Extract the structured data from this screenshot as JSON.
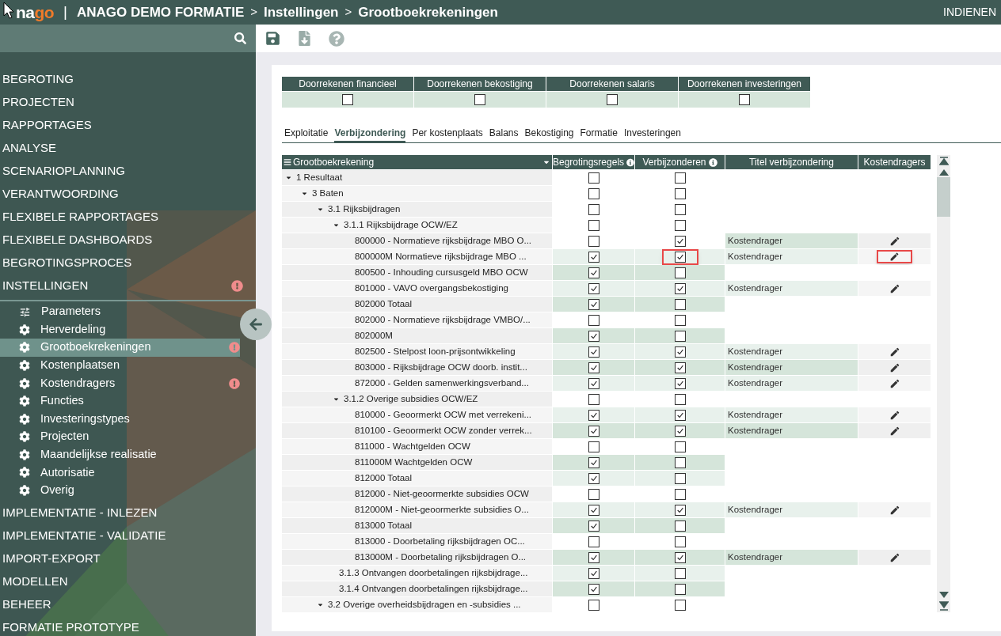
{
  "header": {
    "logo": {
      "main": "na",
      "accent": "go"
    },
    "logo_divider": "|",
    "breadcrumb": [
      {
        "kind": "crumb",
        "text": "ANAGO DEMO FORMATIE"
      },
      {
        "kind": "separator",
        "text": ">"
      },
      {
        "kind": "crumb",
        "text": "Instellingen"
      },
      {
        "kind": "separator",
        "text": ">"
      },
      {
        "kind": "crumb",
        "text": "Grootboekrekeningen"
      }
    ],
    "action": "INDIENEN"
  },
  "sidebar": {
    "items": [
      {
        "label": "BEGROTING"
      },
      {
        "label": "PROJECTEN"
      },
      {
        "label": "RAPPORTAGES"
      },
      {
        "label": "ANALYSE"
      },
      {
        "label": "SCENARIOPLANNING"
      },
      {
        "label": "VERANTWOORDING"
      },
      {
        "label": "FLEXIBELE RAPPORTAGES"
      },
      {
        "label": "FLEXIBELE DASHBOARDS"
      },
      {
        "label": "BEGROTINGSPROCES"
      },
      {
        "label": "INSTELLINGEN",
        "alert": true,
        "children": [
          {
            "label": "Parameters",
            "kind": "sliders",
            "selected": false,
            "alert": false
          },
          {
            "label": "Herverdeling",
            "kind": "gear",
            "selected": false,
            "alert": false
          },
          {
            "label": "Grootboekrekeningen",
            "kind": "gear",
            "selected": true,
            "alert": true
          },
          {
            "label": "Kostenplaatsen",
            "kind": "gear",
            "selected": false,
            "alert": false
          },
          {
            "label": "Kostendragers",
            "kind": "gear",
            "selected": false,
            "alert": true
          },
          {
            "label": "Functies",
            "kind": "gear",
            "selected": false,
            "alert": false
          },
          {
            "label": "Investeringstypes",
            "kind": "gear",
            "selected": false,
            "alert": false
          },
          {
            "label": "Projecten",
            "kind": "gear",
            "selected": false,
            "alert": false
          },
          {
            "label": "Maandelijkse realisatie",
            "kind": "gear",
            "selected": false,
            "alert": false
          },
          {
            "label": "Autorisatie",
            "kind": "gear",
            "selected": false,
            "alert": false
          },
          {
            "label": "Overig",
            "kind": "gear",
            "selected": false,
            "alert": false
          }
        ]
      },
      {
        "label": "IMPLEMENTATIE - INLEZEN"
      },
      {
        "label": "IMPLEMENTATIE - VALIDATIE"
      },
      {
        "label": "IMPORT-EXPORT"
      },
      {
        "label": "MODELLEN"
      },
      {
        "label": "BEHEER"
      },
      {
        "label": "FORMATIE PROTOTYPE"
      }
    ]
  },
  "recalc_options": [
    {
      "label": "Doorrekenen financieel",
      "checked": false
    },
    {
      "label": "Doorrekenen bekostiging",
      "checked": false
    },
    {
      "label": "Doorrekenen salaris",
      "checked": false
    },
    {
      "label": "Doorrekenen investeringen",
      "checked": false
    }
  ],
  "tabs": [
    {
      "label": "Exploitatie",
      "selected": false
    },
    {
      "label": "Verbijzondering",
      "selected": true
    },
    {
      "label": "Per kostenplaats",
      "selected": false
    },
    {
      "label": "Balans",
      "selected": false
    },
    {
      "label": "Bekostiging",
      "selected": false
    },
    {
      "label": "Formatie",
      "selected": false
    },
    {
      "label": "Investeringen",
      "selected": false
    }
  ],
  "table": {
    "columns": [
      "Grootboekrekening",
      "Begrotingsregels",
      "Verbijzonderen",
      "Titel verbijzondering",
      "Kostendragers"
    ],
    "rows": [
      {
        "name": "1 Resultaat",
        "expanded": true,
        "budget": false,
        "separate": false,
        "highlighted": false,
        "children": [
          {
            "name": "3 Baten",
            "expanded": true,
            "budget": false,
            "separate": false,
            "highlighted": false,
            "children": [
              {
                "name": "3.1 Rijksbijdragen",
                "expanded": true,
                "budget": false,
                "separate": false,
                "highlighted": false,
                "children": [
                  {
                    "name": "3.1.1 Rijksbijdrage OCW/EZ",
                    "expanded": true,
                    "budget": false,
                    "separate": false,
                    "highlighted": false,
                    "children": [
                      {
                        "name": "800000 - Normatieve rijksbijdrage MBO O...",
                        "budget": false,
                        "separate": true,
                        "title": "Kostendrager",
                        "edit": true,
                        "highlighted": false
                      },
                      {
                        "name": "800000M Normatieve rijksbijdrage MBO ...",
                        "budget": true,
                        "separate": true,
                        "title": "Kostendrager",
                        "edit": true,
                        "highlighted": true
                      },
                      {
                        "name": "800500 - Inhouding cursusgeld MBO OCW",
                        "budget": true,
                        "separate": false,
                        "edit": false,
                        "highlighted": false
                      },
                      {
                        "name": "801000 - VAVO overgangsbekostiging",
                        "budget": true,
                        "separate": true,
                        "title": "Kostendrager",
                        "edit": true,
                        "highlighted": false
                      },
                      {
                        "name": "802000 Totaal",
                        "budget": true,
                        "separate": false,
                        "edit": false,
                        "highlighted": false
                      },
                      {
                        "name": "802000 - Normatieve rijksbijdrage VMBO/...",
                        "budget": false,
                        "separate": false,
                        "edit": false,
                        "highlighted": false
                      },
                      {
                        "name": "802000M",
                        "budget": true,
                        "separate": false,
                        "edit": false,
                        "highlighted": false
                      },
                      {
                        "name": "802500 - Stelpost loon-prijsontwikkeling",
                        "budget": true,
                        "separate": true,
                        "title": "Kostendrager",
                        "edit": true,
                        "highlighted": false
                      },
                      {
                        "name": "803000 - Rijksbijdrage OCW doorb. instit...",
                        "budget": true,
                        "separate": true,
                        "title": "Kostendrager",
                        "edit": true,
                        "highlighted": false
                      },
                      {
                        "name": "872000 - Gelden samenwerkingsverband...",
                        "budget": true,
                        "separate": true,
                        "title": "Kostendrager",
                        "edit": true,
                        "highlighted": false
                      }
                    ]
                  },
                  {
                    "name": "3.1.2 Overige subsidies OCW/EZ",
                    "expanded": true,
                    "budget": false,
                    "separate": false,
                    "highlighted": false,
                    "children": [
                      {
                        "name": "810000 - Geoormerkt OCW met verrekeni...",
                        "budget": true,
                        "separate": true,
                        "title": "Kostendrager",
                        "edit": true,
                        "highlighted": false
                      },
                      {
                        "name": "810100 - Geoormerkt OCW zonder verrek...",
                        "budget": true,
                        "separate": true,
                        "title": "Kostendrager",
                        "edit": true,
                        "highlighted": false
                      },
                      {
                        "name": "811000 - Wachtgelden OCW",
                        "budget": false,
                        "separate": false,
                        "edit": false,
                        "highlighted": false
                      },
                      {
                        "name": "811000M Wachtgelden OCW",
                        "budget": true,
                        "separate": false,
                        "edit": false,
                        "highlighted": false
                      },
                      {
                        "name": "812000 Totaal",
                        "budget": true,
                        "separate": false,
                        "edit": false,
                        "highlighted": false
                      },
                      {
                        "name": "812000 - Niet-geoormerkte subsidies OCW",
                        "budget": false,
                        "separate": false,
                        "edit": false,
                        "highlighted": false
                      },
                      {
                        "name": "812000M - Niet-geoormerkte subsidies O...",
                        "budget": true,
                        "separate": true,
                        "title": "Kostendrager",
                        "edit": true,
                        "highlighted": false
                      },
                      {
                        "name": "813000 Totaal",
                        "budget": true,
                        "separate": false,
                        "edit": false,
                        "highlighted": false
                      },
                      {
                        "name": "813000 - Doorbetaling rijksbijdragen OC...",
                        "budget": false,
                        "separate": false,
                        "edit": false,
                        "highlighted": false
                      },
                      {
                        "name": "813000M - Doorbetaling rijksbijdragen O...",
                        "budget": true,
                        "separate": true,
                        "title": "Kostendrager",
                        "edit": true,
                        "highlighted": false
                      }
                    ]
                  },
                  {
                    "name": "3.1.3 Ontvangen doorbetalingen rijksbijdrage...",
                    "budget": true,
                    "separate": false,
                    "edit": false,
                    "highlighted": false
                  },
                  {
                    "name": "3.1.4 Ontvangen doorbetalingen rijksbijdrage...",
                    "budget": true,
                    "separate": false,
                    "edit": false,
                    "highlighted": false
                  }
                ]
              },
              {
                "name": "3.2 Overige overheidsbijdragen en -subsidies ...",
                "expanded": true,
                "budget": false,
                "separate": false,
                "highlighted": false
              }
            ]
          }
        ]
      }
    ]
  }
}
